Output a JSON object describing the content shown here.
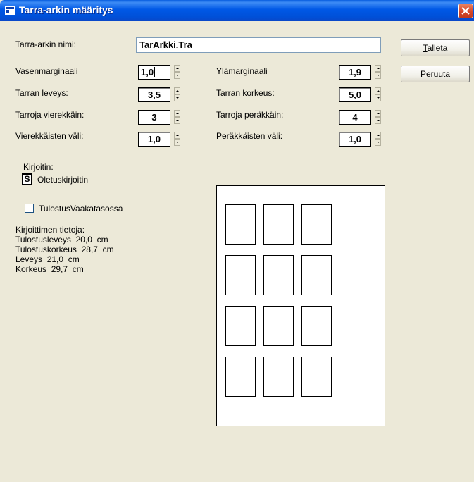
{
  "window": {
    "title": "Tarra-arkin määritys",
    "app_icon": "app-window-icon",
    "close_icon": "close-icon"
  },
  "form": {
    "name_label": "Tarra-arkin nimi:",
    "name_value": "TarArkki.Tra",
    "left": [
      {
        "label": "Vasenmarginaali",
        "value": "1,0"
      },
      {
        "label": "Tarran leveys:",
        "value": "3,5"
      },
      {
        "label": "Tarroja vierekkäin:",
        "value": "3"
      },
      {
        "label": "Vierekkäisten väli:",
        "value": "1,0"
      }
    ],
    "right": [
      {
        "label": "Ylämarginaali",
        "value": "1,9"
      },
      {
        "label": "Tarran korkeus:",
        "value": "5,0"
      },
      {
        "label": "Tarroja peräkkäin:",
        "value": "4"
      },
      {
        "label": "Peräkkäisten väli:",
        "value": "1,0"
      }
    ]
  },
  "buttons": {
    "save": {
      "mnemonic": "T",
      "rest": "alleta"
    },
    "cancel": {
      "mnemonic": "P",
      "rest": "eruuta"
    }
  },
  "printer": {
    "label": "Kirjoitin:",
    "badge": "S",
    "name": "Oletuskirjoitin",
    "landscape_label": "TulostusVaakatasossa",
    "landscape_checked": false
  },
  "printer_info": {
    "heading": "Kirjoittimen tietoja:",
    "rows": [
      {
        "label": "Tulostusleveys",
        "value": "20,0",
        "unit": "cm"
      },
      {
        "label": "Tulostuskorkeus",
        "value": "28,7",
        "unit": "cm"
      },
      {
        "label": "Leveys",
        "value": "21,0",
        "unit": "cm"
      },
      {
        "label": "Korkeus",
        "value": "29,7",
        "unit": "cm"
      }
    ]
  },
  "preview": {
    "columns": 3,
    "rows": 4
  }
}
